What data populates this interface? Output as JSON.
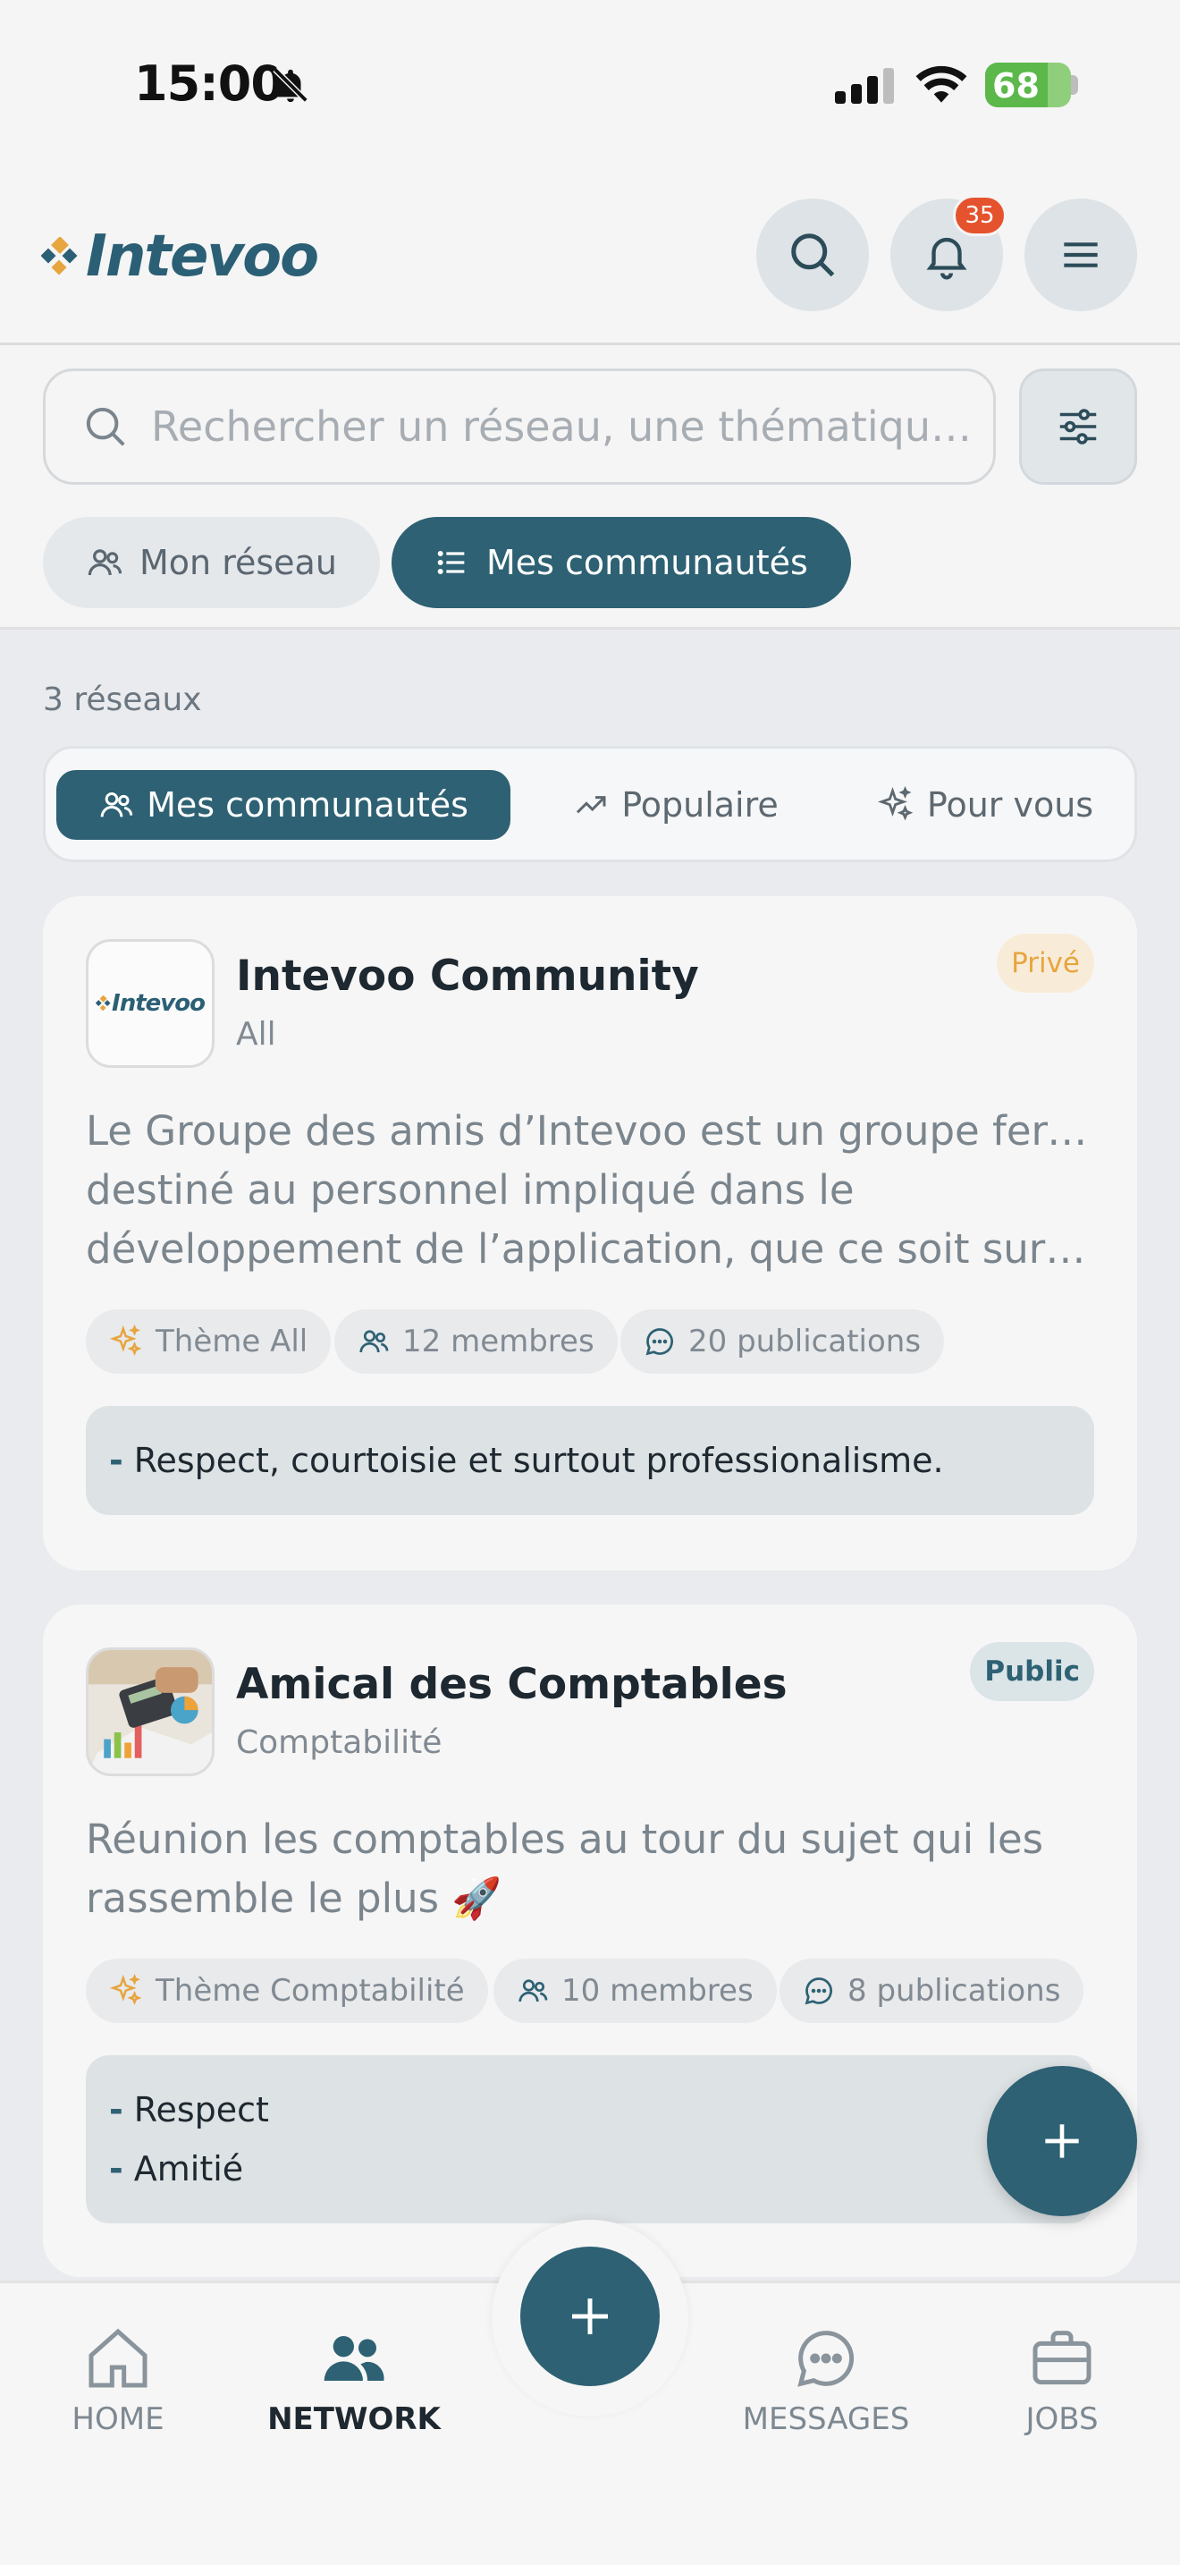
{
  "status": {
    "time": "15:00",
    "battery": "68"
  },
  "header": {
    "logo_text": "Intevoo",
    "notification_count": "35"
  },
  "search": {
    "placeholder": "Rechercher un réseau, une thématique..."
  },
  "scope_tabs": [
    {
      "label": "Mon réseau",
      "active": false
    },
    {
      "label": "Mes communautés",
      "active": true
    }
  ],
  "count_label": "3 réseaux",
  "segments": [
    {
      "label": "Mes communautés",
      "active": true
    },
    {
      "label": "Populaire",
      "active": false
    },
    {
      "label": "Pour vous",
      "active": false
    }
  ],
  "cards": [
    {
      "title": "Intevoo Community",
      "subtitle": "All",
      "visibility": "Privé",
      "avatar_text": "Intevoo",
      "description_lines": [
        "Le Groupe des amis d’Intevoo est un groupe fermé",
        "destiné au personnel impliqué dans le",
        "développement de l’application, que ce soit sur l..."
      ],
      "chips": {
        "theme": "Thème All",
        "members": "12 membres",
        "posts": "20 publications"
      },
      "rules": [
        "Respect, courtoisie et surtout professionalisme."
      ]
    },
    {
      "title": "Amical des Comptables",
      "subtitle": "Comptabilité",
      "visibility": "Public",
      "description_lines": [
        "Réunion les comptables au tour du sujet qui les",
        "rassemble le plus 🚀"
      ],
      "chips": {
        "theme": "Thème Comptabilité",
        "members": "10 membres",
        "posts": "8 publications"
      },
      "rules": [
        "Respect",
        "Amitié"
      ]
    }
  ],
  "bottom_nav": [
    {
      "label": "HOME",
      "icon": "home-icon",
      "active": false
    },
    {
      "label": "NETWORK",
      "icon": "people-icon",
      "active": true
    },
    {
      "label": "MESSAGES",
      "icon": "chat-icon",
      "active": false
    },
    {
      "label": "JOBS",
      "icon": "briefcase-icon",
      "active": false
    }
  ],
  "colors": {
    "primary": "#2d6173",
    "accent": "#e7a53f",
    "badge": "#e4532d"
  }
}
